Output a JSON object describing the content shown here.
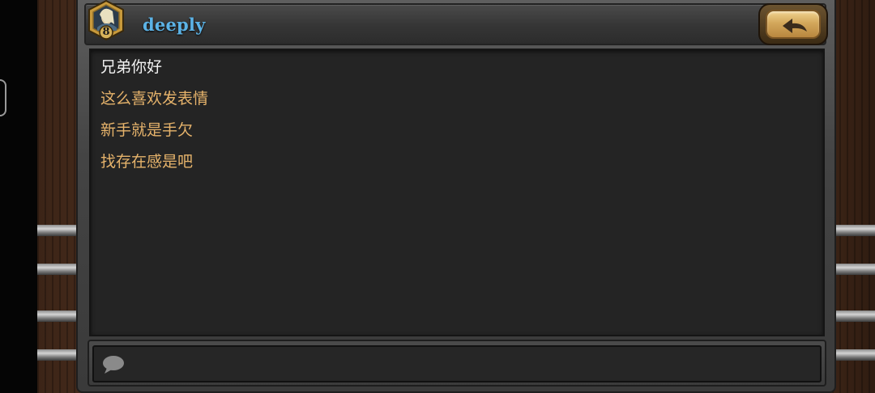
{
  "header": {
    "player_name": "deeply",
    "player_level": "8",
    "avatar_icon": "hero-portrait-icon",
    "back_icon": "back-arrow-icon"
  },
  "messages": [
    {
      "text": "兄弟你好",
      "color": "#f2f2f2"
    },
    {
      "text": "这么喜欢发表情",
      "color": "#e6b36b"
    },
    {
      "text": "新手就是手欠",
      "color": "#e6b36b"
    },
    {
      "text": "找存在感是吧",
      "color": "#e6b36b"
    }
  ],
  "input": {
    "icon": "chat-bubble-icon",
    "value": "",
    "placeholder": ""
  },
  "colors": {
    "name": "#5cb3e6",
    "own_message": "#f2f2f2",
    "friend_message": "#e6b36b",
    "panel": "#242424"
  }
}
